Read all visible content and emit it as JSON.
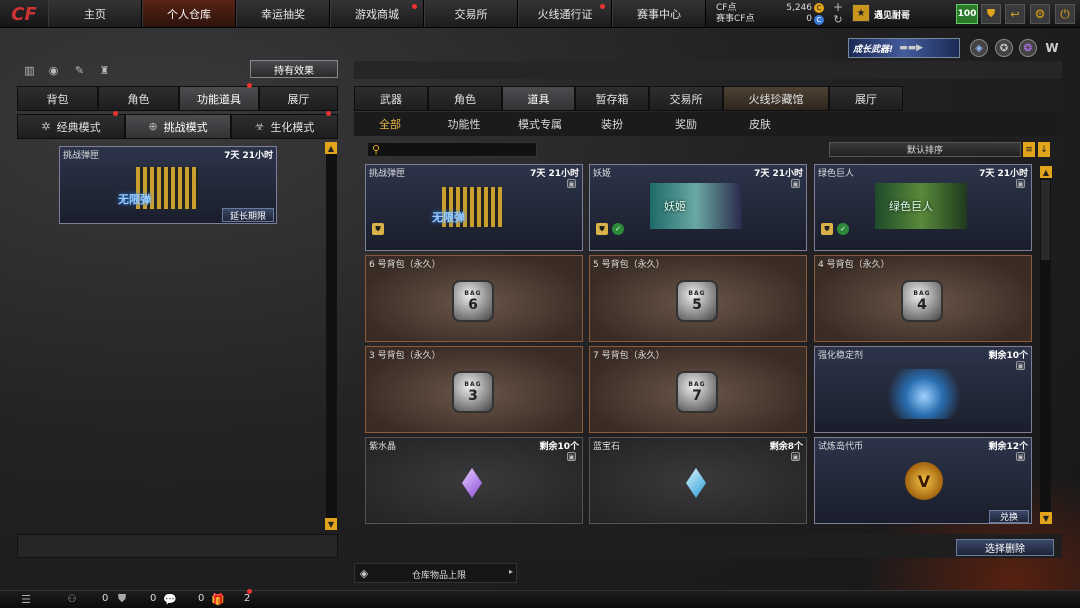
{
  "nav": {
    "logo": "CF",
    "items": [
      "主页",
      "个人仓库",
      "幸运抽奖",
      "游戏商城",
      "交易所",
      "火线通行证",
      "赛事中心"
    ],
    "cf_label": "CF点",
    "cf_value": "5,246",
    "cfs_label": "赛事CF点",
    "cfs_value": "0",
    "username": "遇见耐哥",
    "level": "100"
  },
  "left": {
    "hold_effect": "持有效果",
    "tabs": [
      "背包",
      "角色",
      "功能道具",
      "展厅"
    ],
    "modes": [
      "经典模式",
      "挑战模式",
      "生化模式"
    ],
    "item": {
      "name": "挑战弹匣",
      "time": "7天 21小时",
      "extend": "延长期限",
      "art": "无限弹"
    }
  },
  "right": {
    "banner": "成长武器!",
    "tabs": [
      "武器",
      "角色",
      "道具",
      "暂存箱",
      "交易所",
      "火线珍藏馆",
      "展厅"
    ],
    "subtabs": [
      "全部",
      "功能性",
      "模式专属",
      "装扮",
      "奖励",
      "皮肤"
    ],
    "sort": "默认排序",
    "cards": [
      {
        "name": "挑战弹匣",
        "time": "7天 21小时",
        "art": "无限弹"
      },
      {
        "name": "妖姬",
        "time": "7天 21小时",
        "art": "妖姬"
      },
      {
        "name": "绿色巨人",
        "time": "7天 21小时",
        "art": "绿色巨人"
      },
      {
        "name": "6 号背包（永久）",
        "num": "6"
      },
      {
        "name": "5 号背包（永久）",
        "num": "5"
      },
      {
        "name": "4 号背包（永久）",
        "num": "4"
      },
      {
        "name": "3 号背包（永久）",
        "num": "3"
      },
      {
        "name": "7 号背包（永久）",
        "num": "7"
      },
      {
        "name": "强化稳定剂",
        "time": "剩余10个"
      },
      {
        "name": "紫水晶",
        "time": "剩余10个"
      },
      {
        "name": "蓝宝石",
        "time": "剩余8个"
      },
      {
        "name": "试炼岛代币",
        "time": "剩余12个",
        "btn": "兑换"
      }
    ],
    "bag_tag": "BAG",
    "select_delete": "选择删除",
    "limit": "仓库物品上限"
  },
  "footer": {
    "c1": "0",
    "c2": "0",
    "c3": "0",
    "c4": "2"
  }
}
